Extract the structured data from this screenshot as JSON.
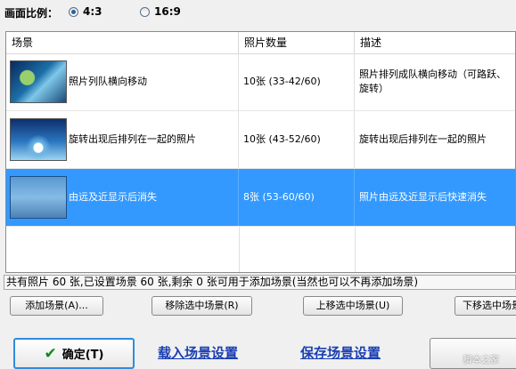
{
  "ratio": {
    "label": "画面比例：",
    "options": [
      {
        "label": "4:3",
        "selected": true
      },
      {
        "label": "16:9",
        "selected": false
      }
    ]
  },
  "table": {
    "columns": [
      "场景",
      "照片数量",
      "描述"
    ],
    "rows": [
      {
        "name": "照片列队横向移动",
        "count": "10张 (33-42/60)",
        "desc": "照片排列成队横向移动（可路跃、旋转）",
        "selected": false,
        "thumb": "blue-landscape-thumbnail"
      },
      {
        "name": "旋转出现后排列在一起的照片",
        "count": "10张 (43-52/60)",
        "desc": "旋转出现后排列在一起的照片",
        "selected": false,
        "thumb": "water-splash-thumbnail"
      },
      {
        "name": "由远及近显示后消失",
        "count": "8张 (53-60/60)",
        "desc": "照片由远及近显示后快速消失",
        "selected": true,
        "thumb": "blue-pattern-thumbnail"
      }
    ]
  },
  "status_text": "共有照片 60 张,已设置场景 60 张,剩余 0 张可用于添加场景(当然也可以不再添加场景)",
  "buttons": {
    "add": "添加场景(A)...",
    "remove": "移除选中场景(R)",
    "move_up": "上移选中场景(U)",
    "move_down": "下移选中场景"
  },
  "footer": {
    "ok": "确定(T)",
    "load": "载入场景设置",
    "save": "保存场景设置"
  },
  "watermark": "脚本之家",
  "colors": {
    "selection": "#3399ff",
    "link": "#1a3fb3",
    "ok_check": "#0e8a1c"
  }
}
